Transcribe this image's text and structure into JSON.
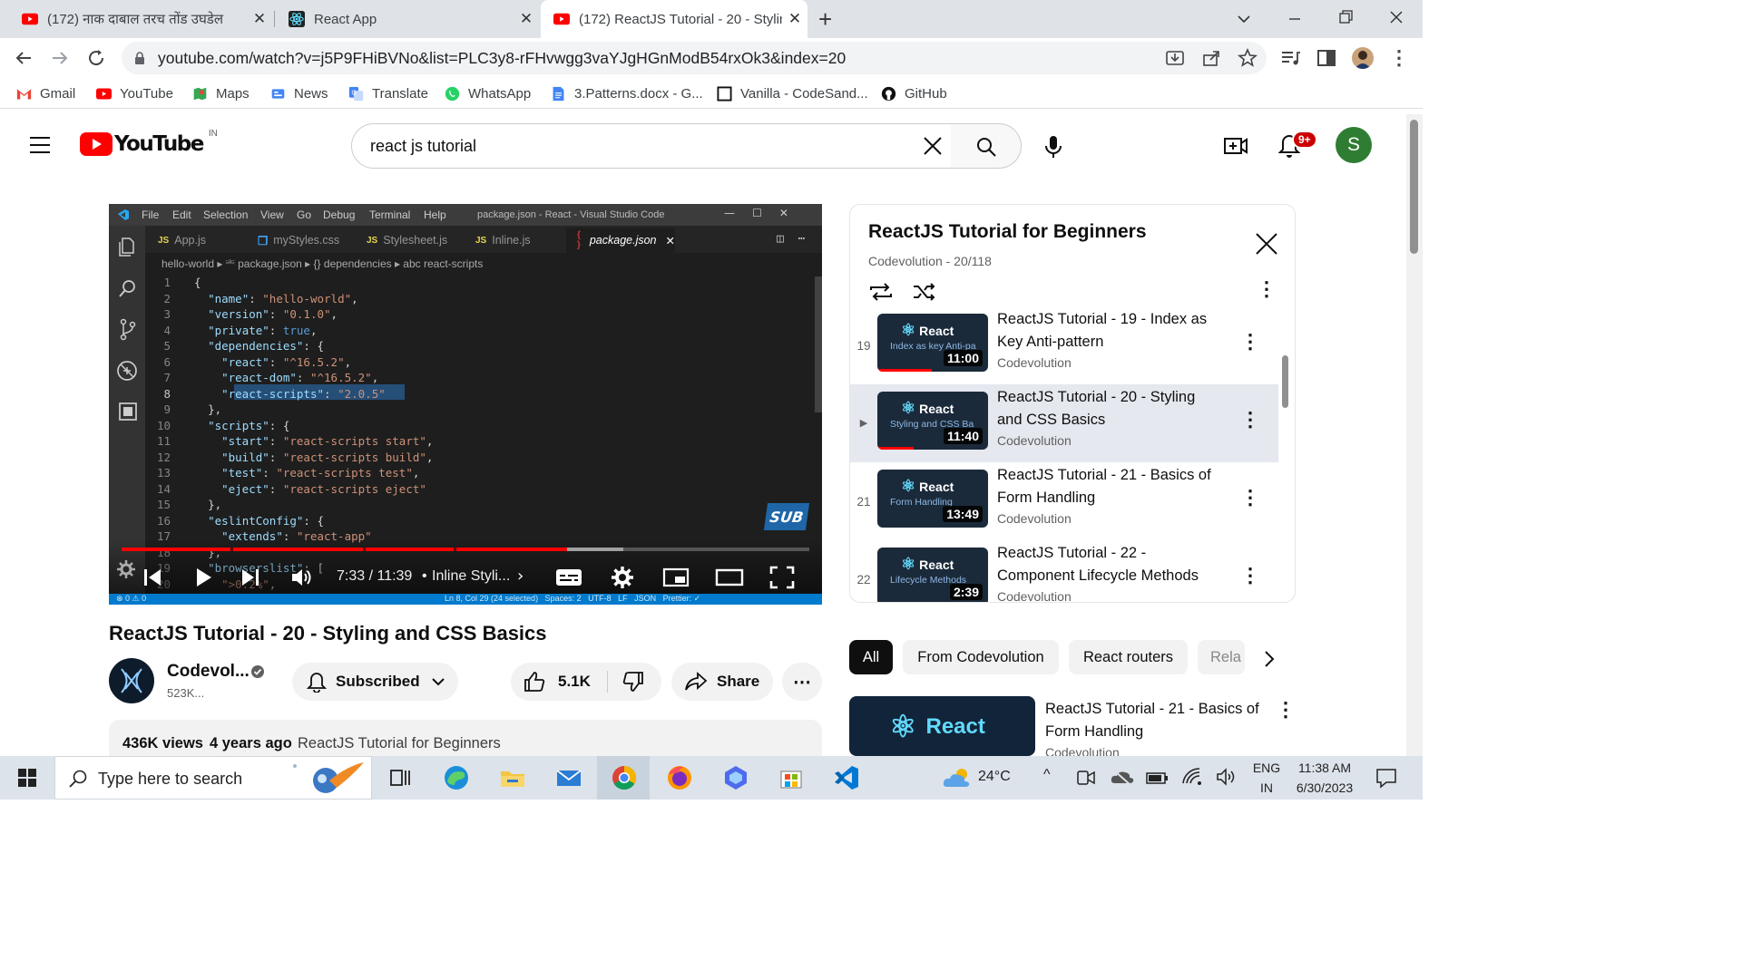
{
  "browser": {
    "tabs": [
      {
        "title": "(172) नाक दाबाल तरच तोंड उघडेल",
        "close": "✕"
      },
      {
        "title": "React App",
        "close": "✕"
      },
      {
        "title": "(172) ReactJS Tutorial - 20 - Stylin",
        "close": "✕"
      }
    ],
    "new_tab": "+",
    "url": "youtube.com/watch?v=j5P9FHiBVNo&list=PLC3y8-rFHvwgg3vaYJgHGnModB54rxOk3&index=20",
    "bookmarks": [
      "Gmail",
      "YouTube",
      "Maps",
      "News",
      "Translate",
      "WhatsApp",
      "3.Patterns.docx - G...",
      "Vanilla - CodeSand...",
      "GitHub"
    ]
  },
  "youtube": {
    "logo_text": "YouTube",
    "country": "IN",
    "search_value": "react js tutorial",
    "notif_badge": "9+",
    "avatar_letter": "S"
  },
  "vscode": {
    "menu": [
      "File",
      "Edit",
      "Selection",
      "View",
      "Go",
      "Debug",
      "Terminal",
      "Help"
    ],
    "window_title": "package.json - React - Visual Studio Code",
    "tabs": [
      "App.js",
      "myStyles.css",
      "Stylesheet.js",
      "Inline.js",
      "package.json"
    ],
    "breadcrumb": "hello-world ▸ ⎃ package.json ▸ {} dependencies ▸ abc react-scripts",
    "status_left": "⊗ 0 ⚠ 0",
    "status_right": "Ln 8, Col 29 (24 selected)   Spaces: 2   UTF-8   LF   JSON   Prettier: ✓"
  },
  "player": {
    "time": "7:33 / 11:39",
    "chapter": "Inline Styli...",
    "sub_badge": "SUB",
    "progress_fraction": 0.648,
    "buffer_fraction": 0.73
  },
  "video": {
    "title": "ReactJS Tutorial - 20 - Styling and CSS Basics",
    "channel": "Codevol...",
    "subscribers": "523K...",
    "subscribed_label": "Subscribed",
    "likes": "5.1K",
    "share_label": "Share",
    "views": "436K views",
    "age": "4 years ago",
    "playlist_link": "ReactJS Tutorial for Beginners"
  },
  "playlist": {
    "title": "ReactJS Tutorial for Beginners",
    "subtitle": "Codevolution - 20/118",
    "items": [
      {
        "index": "19",
        "title": "ReactJS Tutorial - 19 - Index as Key Anti-pattern",
        "channel": "Codevolution",
        "duration": "11:00",
        "thumb_text": "Index as key Anti-pa",
        "brand": "React"
      },
      {
        "index": "▶",
        "title": "ReactJS Tutorial - 20 - Styling and CSS Basics",
        "channel": "Codevolution",
        "duration": "11:40",
        "thumb_text": "Styling and CSS Ba",
        "brand": "React"
      },
      {
        "index": "21",
        "title": "ReactJS Tutorial - 21 - Basics of Form Handling",
        "channel": "Codevolution",
        "duration": "13:49",
        "thumb_text": "Form Handling",
        "brand": "React"
      },
      {
        "index": "22",
        "title": "ReactJS Tutorial - 22 - Component Lifecycle Methods",
        "channel": "Codevolution",
        "duration": "2:39",
        "thumb_text": "Lifecycle Methods",
        "brand": "React"
      }
    ]
  },
  "chips": [
    "All",
    "From Codevolution",
    "React routers",
    "Rela"
  ],
  "recommended": {
    "title": "ReactJS Tutorial - 21 - Basics of Form Handling",
    "channel": "Codevolution",
    "brand": "React"
  },
  "taskbar": {
    "search_placeholder": "Type here to search",
    "temperature": "24°C",
    "lang_top": "ENG",
    "lang_bottom": "IN",
    "time": "11:38 AM",
    "date": "6/30/2023"
  },
  "colors": {
    "youtube_red": "#ff0000",
    "vscode_blue": "#007acc",
    "selected_row": "#e5e8ef",
    "avatar_green": "#2e7d32"
  }
}
